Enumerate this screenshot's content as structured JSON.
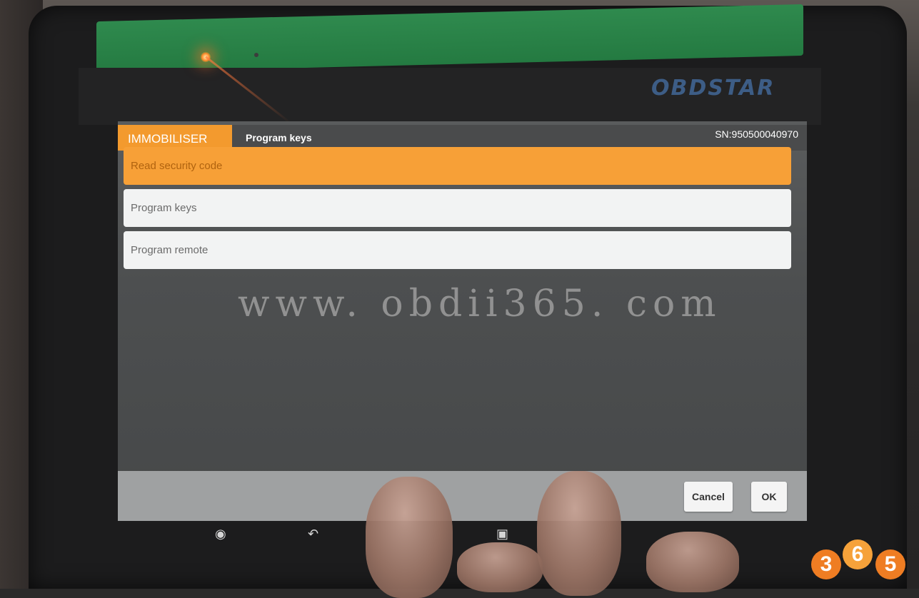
{
  "brand": {
    "name": "OBDSTAR"
  },
  "header": {
    "module_tab": "IMMOBILISER",
    "title": "Program keys",
    "serial": "SN:950500040970"
  },
  "menu": {
    "items": [
      {
        "label": "Read security code",
        "selected": true
      },
      {
        "label": "Program keys",
        "selected": false
      },
      {
        "label": "Program remote",
        "selected": false
      }
    ]
  },
  "watermark": {
    "text": "www. obdii365. com"
  },
  "footer": {
    "cancel_label": "Cancel",
    "ok_label": "OK"
  },
  "navbar": {
    "icons": [
      "home-icon",
      "back-icon",
      "recent-apps-icon"
    ]
  },
  "corner_logo": {
    "digits": [
      "3",
      "6",
      "5"
    ]
  },
  "colors": {
    "accent": "#f39a2e",
    "selected_row": "#f7a037",
    "row_bg": "#f2f3f3",
    "screen_bg": "#4d4f50",
    "footer_bg": "#9fa1a2"
  }
}
